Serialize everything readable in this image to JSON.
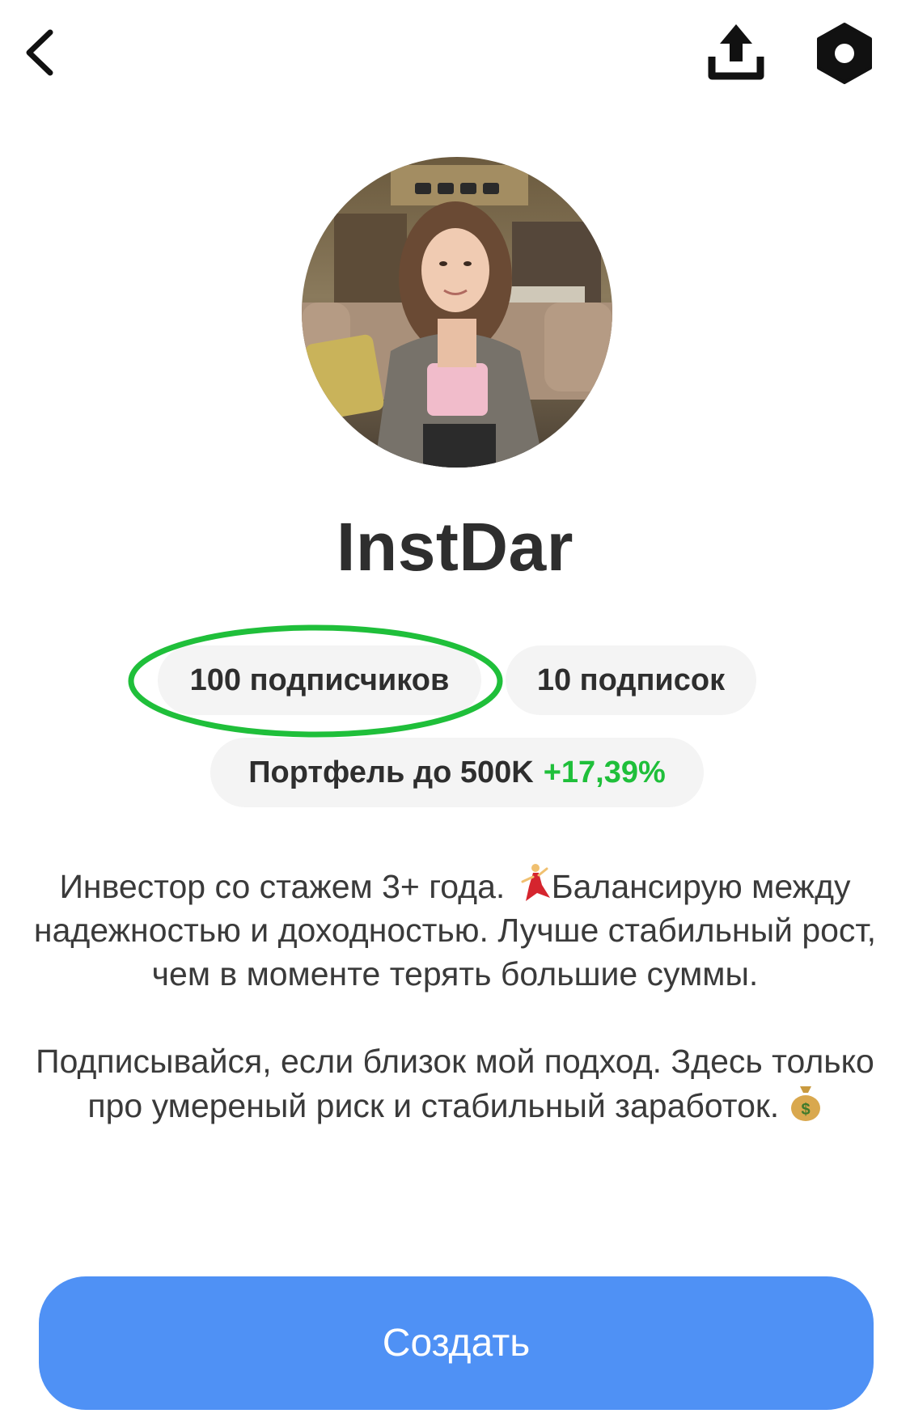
{
  "header": {
    "back_icon": "chevron-left-icon",
    "share_icon": "upload-icon",
    "settings_icon": "hexagon-gear-icon"
  },
  "profile": {
    "avatar": "profile-photo",
    "username": "InstDar",
    "followers_label": "100 подписчиков",
    "following_label": "10 подписок",
    "portfolio_label": "Портфель до 500K",
    "portfolio_change": "+17,39%",
    "highlight_color": "#1fbf3a"
  },
  "bio": {
    "paragraph1_a": "Инвестор со стажем 3+ года. ",
    "paragraph1_emoji": "dancer-emoji",
    "paragraph1_b": "Балансирую между надежностью и доходностью. Лучше стабильный  рост, чем в моменте терять большие суммы.",
    "paragraph2_a": "Подписывайся, если близок мой подход. Здесь только про умереный риск и стабильный заработок. ",
    "paragraph2_emoji": "money-bag-emoji"
  },
  "actions": {
    "create_label": "Создать",
    "create_color": "#4f91f5"
  }
}
